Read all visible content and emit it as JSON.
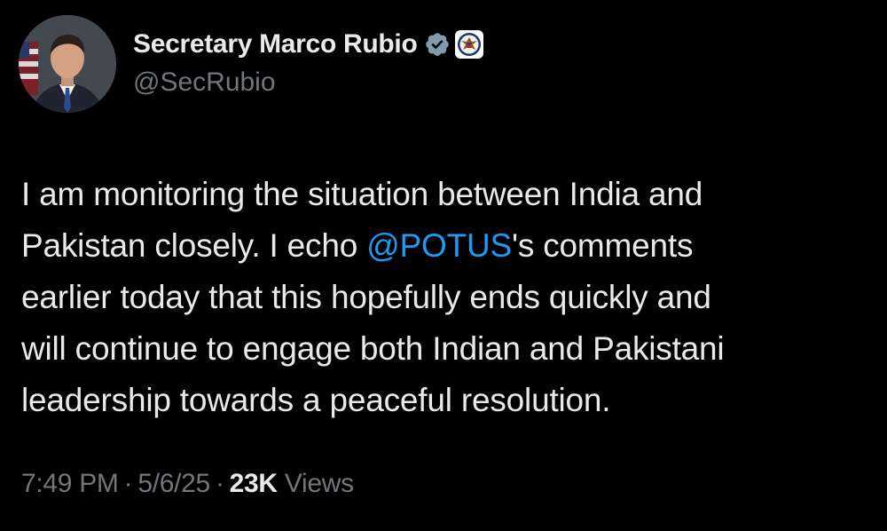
{
  "author": {
    "display_name": "Secretary Marco Rubio",
    "handle": "@SecRubio",
    "verified_badge_color": "#829aab",
    "icons": [
      "verified-badge-icon",
      "state-department-seal-icon"
    ]
  },
  "tweet": {
    "lines": [
      "I am monitoring the situation between India and",
      "Pakistan closely. I echo ",
      "@POTUS",
      "'s comments",
      "earlier today that this hopefully ends quickly and",
      "will continue to engage both Indian and Pakistani",
      "leadership towards a peaceful resolution."
    ],
    "mention_color": "#1d9bf0"
  },
  "meta": {
    "time": "7:49 PM",
    "date": "5/6/25",
    "views_count": "23K",
    "views_label": "Views",
    "separator": "·"
  },
  "colors": {
    "background": "#000000",
    "text": "#e7e9ea",
    "secondary": "#71767b"
  }
}
